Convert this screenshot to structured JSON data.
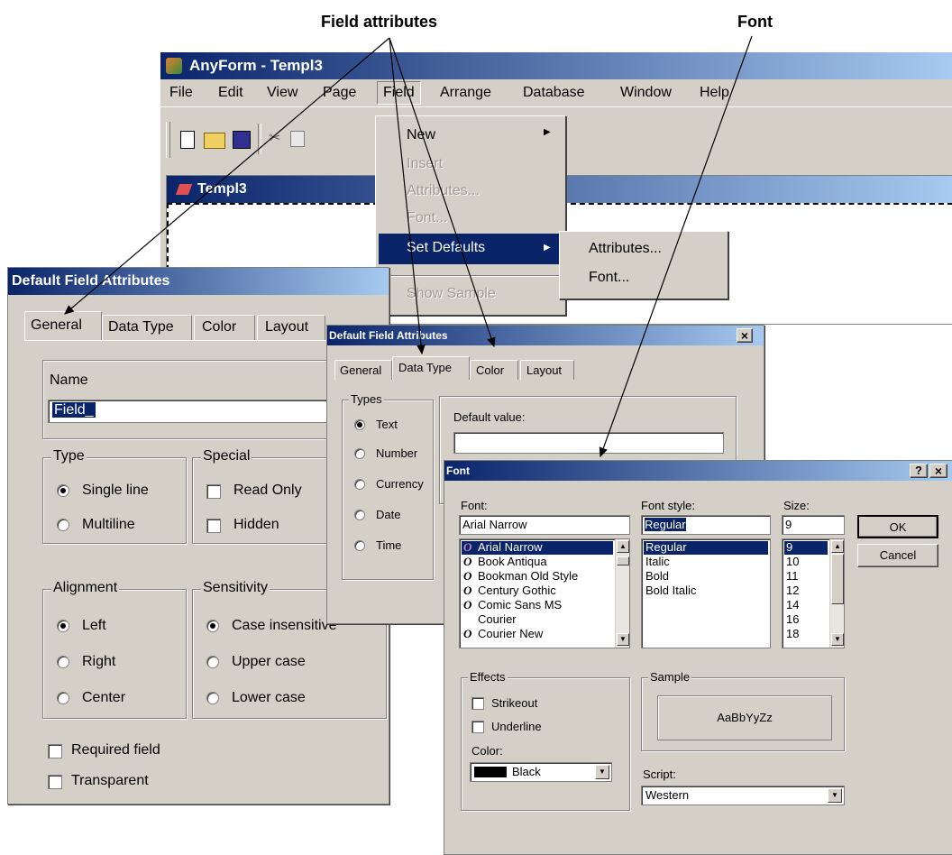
{
  "callouts": {
    "field_attributes": "Field attributes",
    "font": "Font"
  },
  "main_window": {
    "title": "AnyForm - Templ3",
    "menu": [
      "File",
      "Edit",
      "View",
      "Page",
      "Field",
      "Arrange",
      "Database",
      "Window",
      "Help"
    ],
    "doc_title": "Templ3"
  },
  "field_menu": {
    "items": [
      {
        "label": "New",
        "enabled": true,
        "submenu": true
      },
      {
        "label": "Insert",
        "enabled": false
      },
      {
        "label": "Attributes...",
        "enabled": false
      },
      {
        "label": "Font...",
        "enabled": false
      },
      {
        "label": "Set Defaults",
        "enabled": true,
        "submenu": true,
        "highlighted": true
      },
      {
        "label": "Show Sample",
        "enabled": false
      }
    ],
    "submenu": [
      "Attributes...",
      "Font..."
    ]
  },
  "dialog1": {
    "title": "Default Field Attributes",
    "tabs": [
      "General",
      "Data Type",
      "Color",
      "Layout"
    ],
    "name_label": "Name",
    "name_value": "Field_",
    "type_group": "Type",
    "type_options": [
      "Single line",
      "Multiline"
    ],
    "special_group": "Special",
    "special_options": [
      "Read Only",
      "Hidden"
    ],
    "alignment_group": "Alignment",
    "alignment_options": [
      "Left",
      "Right",
      "Center"
    ],
    "sensitivity_group": "Sensitivity",
    "sensitivity_options": [
      "Case insensitive",
      "Upper case",
      "Lower case"
    ],
    "required": "Required field",
    "transparent": "Transparent"
  },
  "dialog2": {
    "title": "Default Field Attributes",
    "close": "×",
    "tabs": [
      "General",
      "Data Type",
      "Color",
      "Layout"
    ],
    "types_group": "Types",
    "types": [
      "Text",
      "Number",
      "Currency",
      "Date",
      "Time"
    ],
    "default_value_label": "Default value:"
  },
  "font_dialog": {
    "title": "Font",
    "help": "?",
    "close": "×",
    "font_label": "Font:",
    "font_value": "Arial Narrow",
    "fonts": [
      "Arial Narrow",
      "Book Antiqua",
      "Bookman Old Style",
      "Century Gothic",
      "Comic Sans MS",
      "Courier",
      "Courier New"
    ],
    "style_label": "Font style:",
    "style_value": "Regular",
    "styles": [
      "Regular",
      "Italic",
      "Bold",
      "Bold Italic"
    ],
    "size_label": "Size:",
    "size_value": "9",
    "sizes": [
      "9",
      "10",
      "11",
      "12",
      "14",
      "16",
      "18"
    ],
    "ok": "OK",
    "cancel": "Cancel",
    "effects_group": "Effects",
    "strikeout": "Strikeout",
    "underline": "Underline",
    "color_label": "Color:",
    "color_value": "Black",
    "sample_group": "Sample",
    "sample_text": "AaBbYyZz",
    "script_label": "Script:",
    "script_value": "Western"
  }
}
